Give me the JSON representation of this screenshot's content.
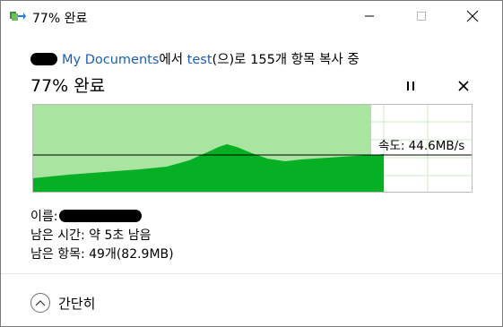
{
  "window": {
    "title": "77% 완료",
    "minimize_glyph": "—",
    "maximize_glyph": "☐",
    "close_glyph": "✕"
  },
  "operation": {
    "source_name": "My Documents",
    "from_word": "에서",
    "dest_name": "test",
    "middle_text": "(으)로 155개 항목 복사 중",
    "percent_title": "77% 완료",
    "progress_fraction": 0.77,
    "speed_text": "속도: 44.6MB/s"
  },
  "details": {
    "name_label": "이름:",
    "time_label": "남은 시간: 약 5초 남음",
    "items_label": "남은 항목: 49개(82.9MB)"
  },
  "footer": {
    "collapse_label": "간단히"
  },
  "colors": {
    "progress_fill": "#a9e5a0",
    "throughput_fill": "#06b025",
    "grid": "#cfe9c9",
    "link": "#1a5fb4"
  },
  "icons": {
    "title": "copy-arrow-icon",
    "pause": "pause-icon",
    "cancel": "close-icon",
    "collapse": "chevron-up-icon"
  }
}
